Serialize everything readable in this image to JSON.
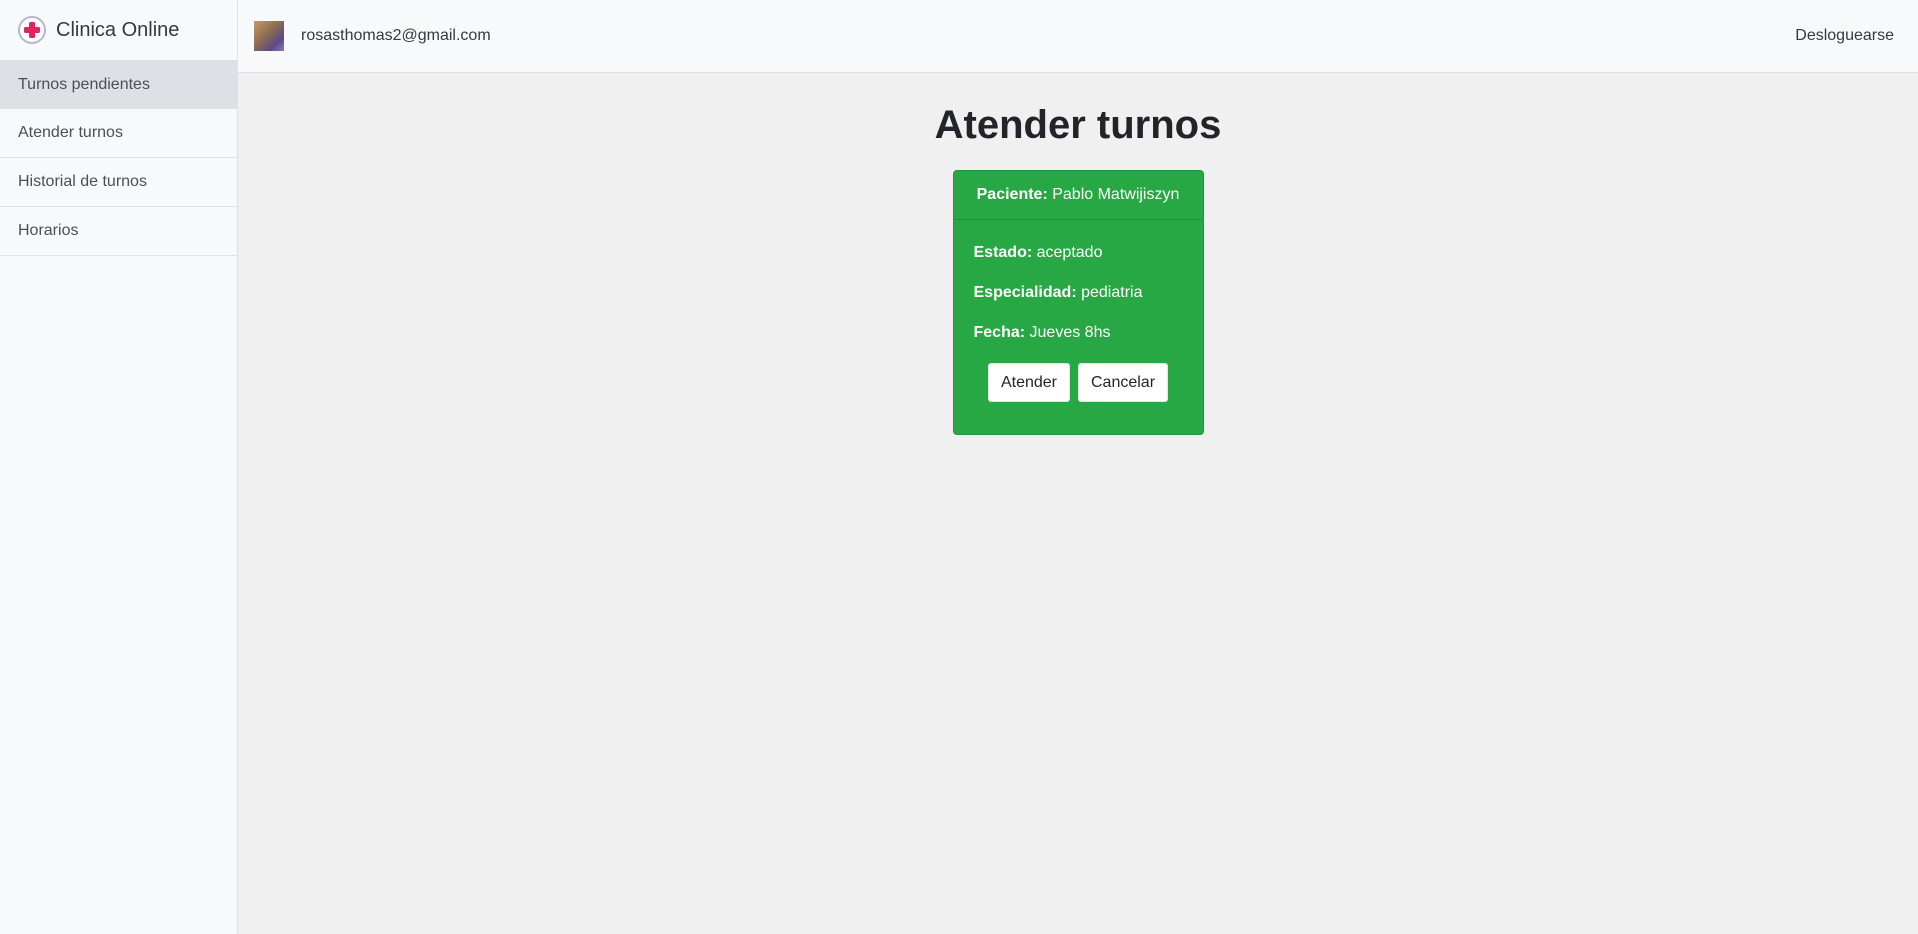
{
  "brand": {
    "name": "Clinica Online",
    "logo_icon": "medical-cross-icon"
  },
  "sidebar": {
    "items": [
      {
        "label": "Turnos pendientes"
      },
      {
        "label": "Atender turnos"
      },
      {
        "label": "Historial de turnos"
      },
      {
        "label": "Horarios"
      }
    ]
  },
  "topbar": {
    "email": "rosasthomas2@gmail.com",
    "logout_label": "Desloguearse"
  },
  "page": {
    "title": "Atender turnos"
  },
  "appointment": {
    "patient_label": "Paciente:",
    "patient_name": "Pablo Matwijiszyn",
    "status_label": "Estado:",
    "status_value": "aceptado",
    "specialty_label": "Especialidad:",
    "specialty_value": "pediatria",
    "date_label": "Fecha:",
    "date_value": "Jueves 8hs",
    "attend_button": "Atender",
    "cancel_button": "Cancelar"
  },
  "colors": {
    "card_green": "#28a745",
    "logo_red": "#e0245e"
  }
}
